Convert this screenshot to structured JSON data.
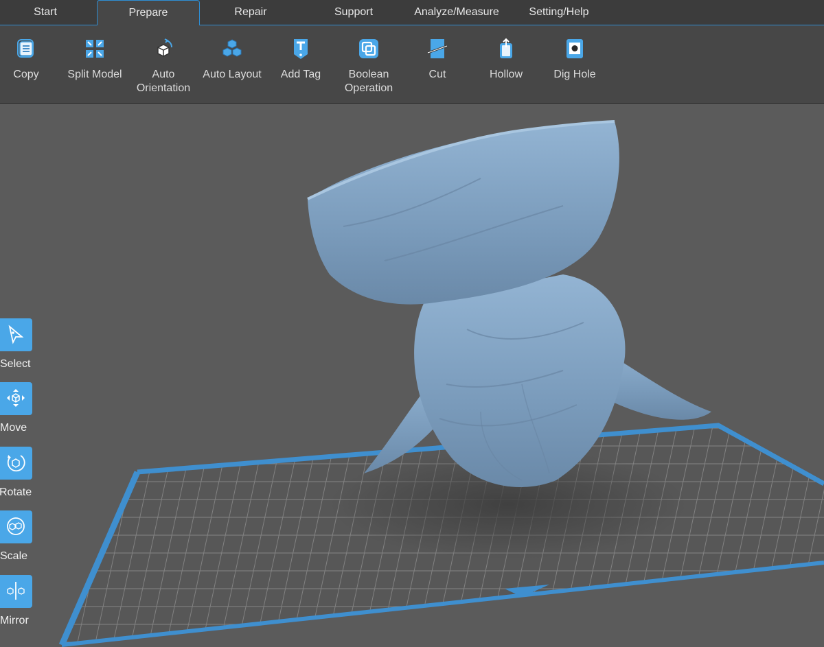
{
  "tabs": [
    {
      "label": "Start"
    },
    {
      "label": "Prepare"
    },
    {
      "label": "Repair"
    },
    {
      "label": "Support"
    },
    {
      "label": "Analyze/Measure"
    },
    {
      "label": "Setting/Help"
    }
  ],
  "active_tab": "Prepare",
  "ribbon": {
    "tools": [
      {
        "label": "Copy",
        "icon": "copy-icon"
      },
      {
        "label": "Split Model",
        "icon": "split-model-icon"
      },
      {
        "label": "Auto\nOrientation",
        "icon": "auto-orientation-icon"
      },
      {
        "label": "Auto Layout",
        "icon": "auto-layout-icon"
      },
      {
        "label": "Add Tag",
        "icon": "add-tag-icon"
      },
      {
        "label": "Boolean\nOperation",
        "icon": "boolean-operation-icon"
      },
      {
        "label": "Cut",
        "icon": "cut-icon"
      },
      {
        "label": "Hollow",
        "icon": "hollow-icon"
      },
      {
        "label": "Dig Hole",
        "icon": "dig-hole-icon"
      }
    ]
  },
  "side_tools": [
    {
      "label": "Select",
      "icon": "select-icon"
    },
    {
      "label": "Move",
      "icon": "move-icon"
    },
    {
      "label": "Rotate",
      "icon": "rotate-icon"
    },
    {
      "label": "Scale",
      "icon": "scale-icon"
    },
    {
      "label": "Mirror",
      "icon": "mirror-icon"
    }
  ],
  "colors": {
    "accent": "#4aa7e8",
    "tab_border": "#2e8fd6",
    "model": "#7f9fbe",
    "platform_edge": "#3f8fcf",
    "background": "#5b5b5b"
  }
}
